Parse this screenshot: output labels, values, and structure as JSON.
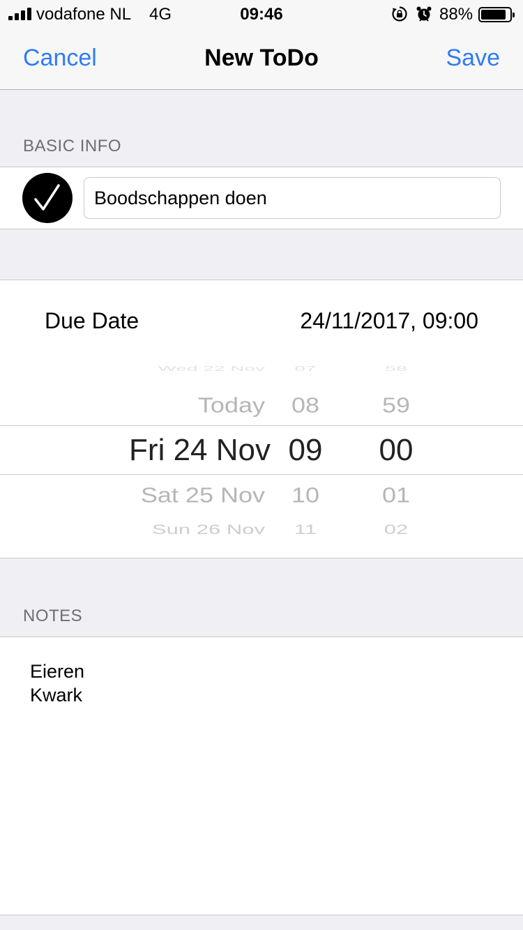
{
  "status_bar": {
    "carrier": "vodafone NL",
    "network": "4G",
    "time": "09:46",
    "battery_percent": "88%",
    "battery_level": 0.88,
    "icons": [
      "signal-bars-icon",
      "orientation-lock-icon",
      "alarm-clock-icon",
      "battery-icon"
    ]
  },
  "nav": {
    "cancel_label": "Cancel",
    "title": "New ToDo",
    "save_label": "Save",
    "accent_color": "#2f7cf6"
  },
  "basic_info": {
    "header": "BASIC INFO",
    "completed": true,
    "title_value": "Boodschappen doen"
  },
  "due_date": {
    "label": "Due Date",
    "value": "24/11/2017, 09:00",
    "picker": {
      "dates": [
        "Wed 22 Nov",
        "Today",
        "Fri 24 Nov",
        "Sat 25 Nov",
        "Sun 26 Nov"
      ],
      "hours": [
        "07",
        "08",
        "09",
        "10",
        "11"
      ],
      "minutes": [
        "58",
        "59",
        "00",
        "01",
        "02"
      ],
      "selected": {
        "date": "Fri 24 Nov",
        "hour": "09",
        "minute": "00"
      }
    }
  },
  "notes": {
    "header": "NOTES",
    "lines": [
      "Eieren",
      "Kwark"
    ]
  }
}
